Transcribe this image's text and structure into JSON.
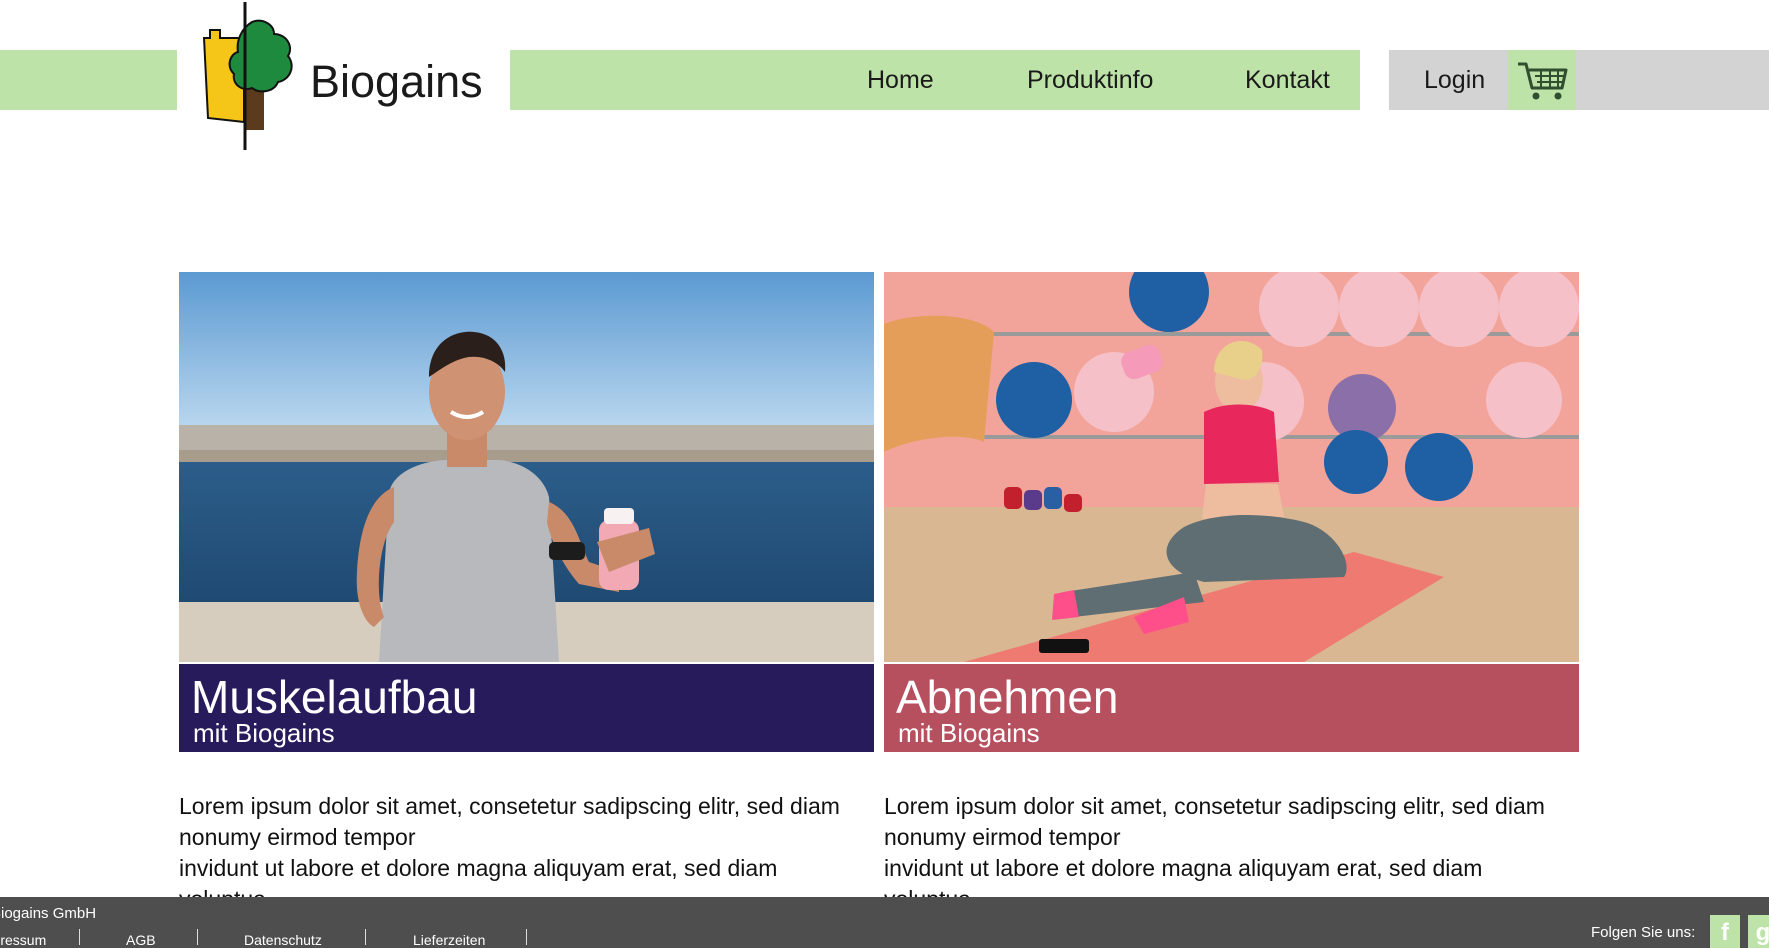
{
  "brand": {
    "name": "Biogains"
  },
  "nav": {
    "items": [
      "Home",
      "Produktinfo",
      "Kontakt"
    ]
  },
  "login": {
    "label": "Login"
  },
  "cards": [
    {
      "title": "Muskelaufbau",
      "subtitle": "mit Biogains",
      "caption_color": "#271b5c",
      "text_lines": [
        "Lorem ipsum dolor sit amet, consetetur sadipscing elitr, sed diam",
        "nonumy eirmod tempor",
        "invidunt ut labore et dolore magna aliquyam erat, sed diam",
        "voluptua."
      ]
    },
    {
      "title": "Abnehmen",
      "subtitle": "mit Biogains",
      "caption_color": "#b7505e",
      "text_lines": [
        "Lorem ipsum dolor sit amet, consetetur sadipscing elitr, sed diam",
        "nonumy eirmod tempor",
        "invidunt ut labore et dolore magna aliquyam erat, sed diam",
        "voluptua."
      ]
    }
  ],
  "footer": {
    "company": "Biogains GmbH",
    "links": [
      "Impressum",
      "AGB",
      "Datenschutz",
      "Lieferzeiten"
    ],
    "follow_label": "Folgen Sie uns:",
    "social": [
      "facebook-icon",
      "google-plus-icon"
    ]
  },
  "colors": {
    "accent_green": "#bde3a9",
    "gray": "#d3d3d3",
    "footer": "#4e4e4e"
  },
  "icons": {
    "cart": "shopping-cart-icon"
  }
}
